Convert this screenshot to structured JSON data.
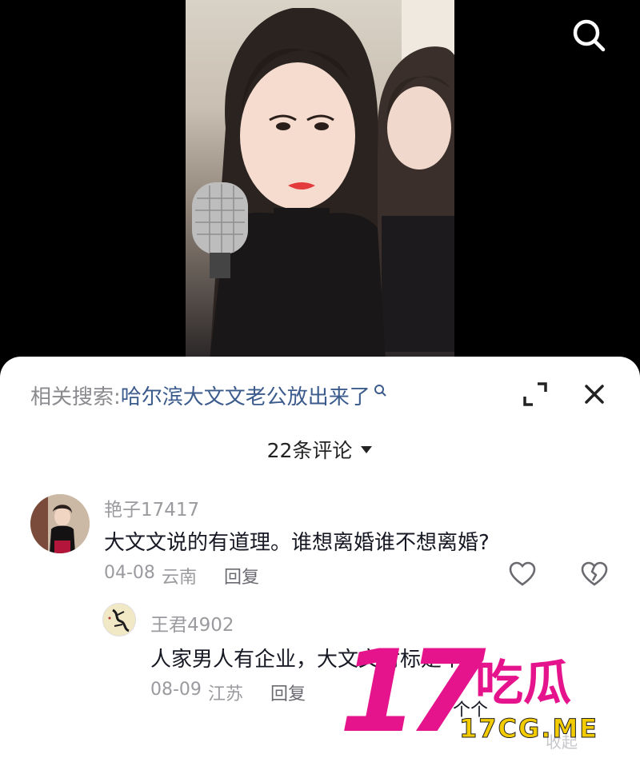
{
  "video": {
    "search_icon": "search-icon"
  },
  "sheet": {
    "related": {
      "label": "相关搜索:",
      "query": "哈尔滨大文文老公放出来了",
      "icon": "search-icon"
    },
    "expand_icon": "expand-icon",
    "close_icon": "close-icon",
    "comment_count": "22条评论",
    "comments": [
      {
        "user": "艳子17417",
        "text": "大文文说的有道理。谁想离婚谁不想离婚?",
        "date": "04-08",
        "location": "云南",
        "reply": "回复",
        "like_icon": "heart-icon",
        "dislike_icon": "broken-heart-icon"
      }
    ],
    "replies": [
      {
        "user": "王君4902",
        "text": "人家男人有企业，大文文对标是个",
        "date": "08-09",
        "location": "江苏",
        "reply": "回复",
        "extra": "个个"
      }
    ],
    "collapse_label": "收起"
  },
  "watermark": {
    "number": "17",
    "chinese": "吃瓜",
    "site": "17CG.ME"
  },
  "colors": {
    "link": "#3b5b8c",
    "muted": "#9a9a9f",
    "watermark_pink": "#e6148c",
    "watermark_yellow": "#f2cc00"
  }
}
